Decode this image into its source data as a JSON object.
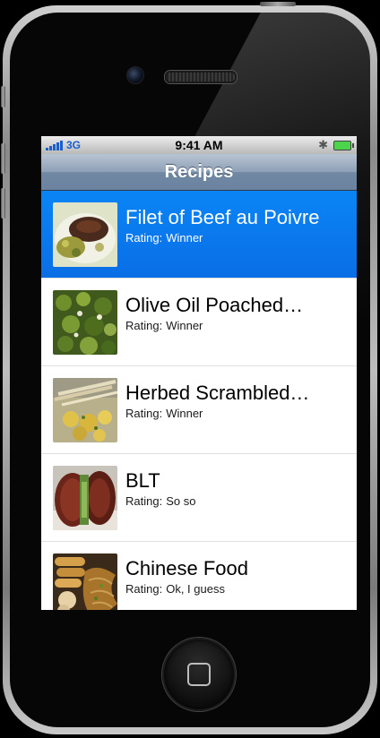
{
  "status_bar": {
    "carrier": "3G",
    "time": "9:41 AM",
    "bluetooth_icon": "bluetooth-icon",
    "battery_icon": "battery-icon"
  },
  "nav": {
    "title": "Recipes"
  },
  "recipes": [
    {
      "name": "Filet of Beef au Poivre",
      "rating_label": "Rating:",
      "rating": "Winner",
      "selected": true
    },
    {
      "name": "Olive Oil Poached…",
      "rating_label": "Rating:",
      "rating": "Winner",
      "selected": false
    },
    {
      "name": "Herbed Scrambled…",
      "rating_label": "Rating:",
      "rating": "Winner",
      "selected": false
    },
    {
      "name": "BLT",
      "rating_label": "Rating:",
      "rating": "So so",
      "selected": false
    },
    {
      "name": "Chinese Food",
      "rating_label": "Rating:",
      "rating": "Ok, I guess",
      "selected": false
    }
  ],
  "colors": {
    "selection": "#0a6ee6",
    "nav_bar": "#7188a3",
    "signal": "#1a5fd0"
  }
}
